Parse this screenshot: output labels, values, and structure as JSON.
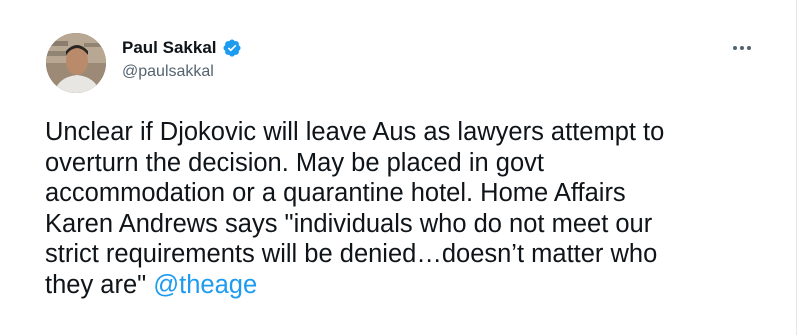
{
  "author": {
    "display_name": "Paul Sakkal",
    "handle": "@paulsakkal",
    "verified": true
  },
  "icons": {
    "verified_badge": "verified-badge-icon",
    "more": "more-options-icon"
  },
  "colors": {
    "verified_blue": "#1d9bf0",
    "link_blue": "#1d9bf0",
    "text_primary": "#0f1419",
    "text_secondary": "#536471"
  },
  "tweet": {
    "lines": [
      "Unclear if Djokovic will leave Aus as lawyers attempt to",
      "overturn the decision. May be placed in govt",
      "accommodation or a quarantine hotel. Home Affairs",
      "Karen Andrews says \"individuals who do not meet our",
      "strict requirements will be denied…doesn’t matter who",
      "they are\" "
    ],
    "mention": "@theage"
  }
}
